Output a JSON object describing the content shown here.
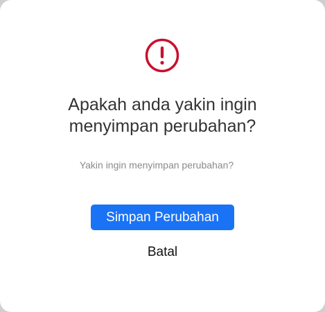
{
  "dialog": {
    "icon": "exclamation-circle-icon",
    "title_line1": "Apakah anda yakin ingin",
    "title_line2": "menyimpan perubahan?",
    "message": "Yakin ingin menyimpan perubahan?",
    "confirm_label": "Simpan Perubahan",
    "cancel_label": "Batal"
  },
  "colors": {
    "warning": "#c8102e",
    "primary": "#1a73f5"
  }
}
